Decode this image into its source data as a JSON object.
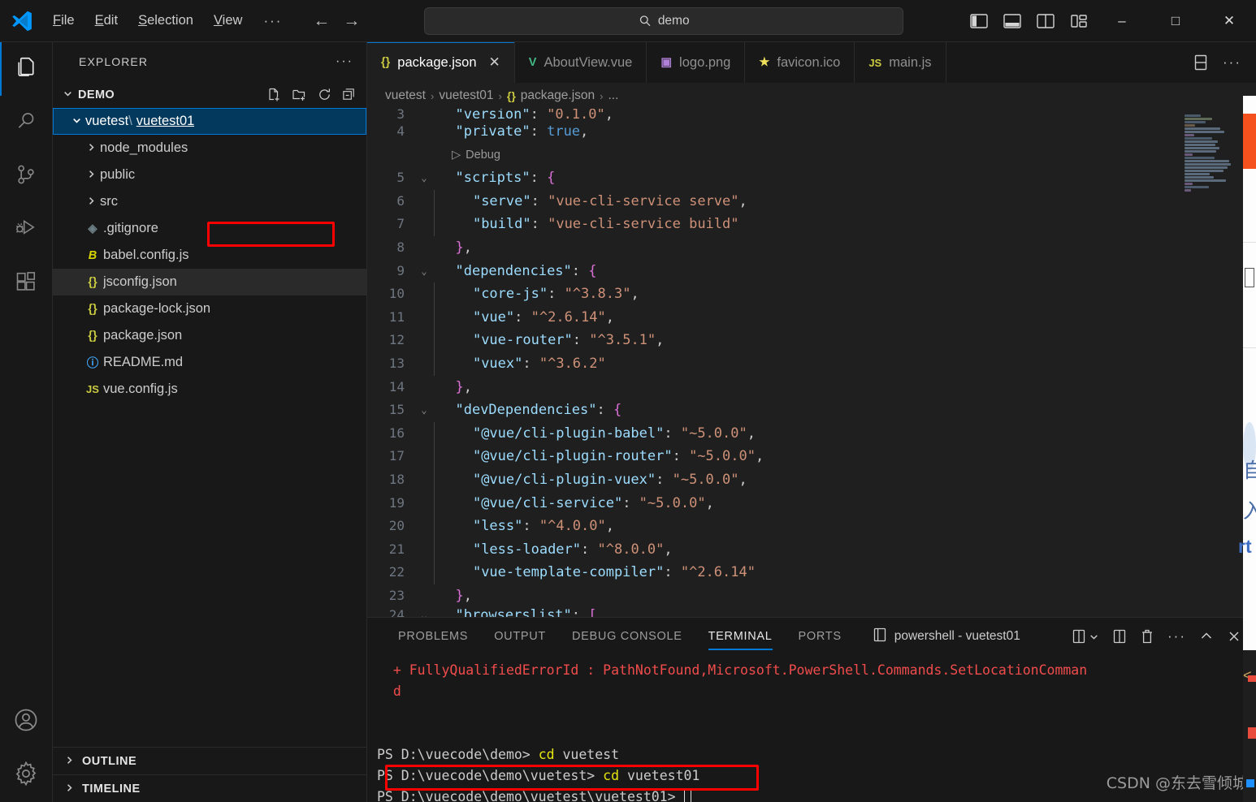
{
  "titlebar": {
    "menu": [
      "File",
      "Edit",
      "Selection",
      "View"
    ],
    "menu_more": "···",
    "back_icon": "←",
    "forward_icon": "→",
    "search_placeholder": "demo",
    "search_value": "demo",
    "window_minimize": "–",
    "window_maximize": "□",
    "window_close": "✕"
  },
  "activitybar": {
    "items": [
      {
        "name": "explorer",
        "title": "Explorer",
        "active": true
      },
      {
        "name": "search",
        "title": "Search",
        "active": false
      },
      {
        "name": "source-control",
        "title": "Source Control",
        "active": false
      },
      {
        "name": "run-debug",
        "title": "Run and Debug",
        "active": false
      },
      {
        "name": "extensions",
        "title": "Extensions",
        "active": false
      }
    ],
    "bottom": [
      {
        "name": "accounts",
        "title": "Accounts"
      },
      {
        "name": "settings",
        "title": "Manage"
      }
    ]
  },
  "sidebar": {
    "title": "EXPLORER",
    "more_label": "···",
    "folder": {
      "label": "DEMO",
      "chevron": "⌄",
      "actions": [
        "new-file",
        "new-folder",
        "refresh",
        "collapse-all"
      ]
    },
    "tree": [
      {
        "label": "vuetest\\vuetest01",
        "label_prefix": "vuetest",
        "label_sep": "\\",
        "label_highlight": "vuetest01",
        "type": "folder",
        "arrow": "⌄",
        "selected": true,
        "indent": 0,
        "annotated": true
      },
      {
        "label": "node_modules",
        "type": "folder",
        "arrow": "›",
        "indent": 1
      },
      {
        "label": "public",
        "type": "folder",
        "arrow": "›",
        "indent": 1
      },
      {
        "label": "src",
        "type": "folder",
        "arrow": "›",
        "indent": 1
      },
      {
        "label": ".gitignore",
        "type": "file",
        "icon": "git",
        "icon_text": "◈",
        "indent": 1
      },
      {
        "label": "babel.config.js",
        "type": "file",
        "icon": "babel",
        "icon_text": "B",
        "indent": 1
      },
      {
        "label": "jsconfig.json",
        "type": "file",
        "icon": "json",
        "icon_text": "{}",
        "indent": 1,
        "hover": true
      },
      {
        "label": "package-lock.json",
        "type": "file",
        "icon": "json",
        "icon_text": "{}",
        "indent": 1
      },
      {
        "label": "package.json",
        "type": "file",
        "icon": "json",
        "icon_text": "{}",
        "indent": 1
      },
      {
        "label": "README.md",
        "type": "file",
        "icon": "md",
        "icon_text": "ⓘ",
        "indent": 1
      },
      {
        "label": "vue.config.js",
        "type": "file",
        "icon": "js",
        "icon_text": "JS",
        "indent": 1
      }
    ],
    "sections": [
      {
        "label": "OUTLINE",
        "chevron": "›"
      },
      {
        "label": "TIMELINE",
        "chevron": "›"
      }
    ]
  },
  "editor": {
    "tabs": [
      {
        "label": "package.json",
        "icon_text": "{}",
        "icon_kind": "json",
        "active": true,
        "has_close": true,
        "close": "✕"
      },
      {
        "label": "AboutView.vue",
        "icon_text": "V",
        "icon_kind": "vue",
        "active": false
      },
      {
        "label": "logo.png",
        "icon_text": "▣",
        "icon_kind": "png",
        "active": false
      },
      {
        "label": "favicon.ico",
        "icon_text": "★",
        "icon_kind": "ico",
        "active": false
      },
      {
        "label": "main.js",
        "icon_text": "JS",
        "icon_kind": "js",
        "active": false
      }
    ],
    "tab_actions": [
      "split-editor-down",
      "more-actions"
    ],
    "breadcrumb": [
      {
        "label": "vuetest",
        "icon": ""
      },
      {
        "label": "vuetest01",
        "icon": ""
      },
      {
        "label": "package.json",
        "icon": "{}"
      },
      {
        "label": "...",
        "icon": ""
      }
    ],
    "breadcrumb_sep": "›",
    "codelens": {
      "icon": "▷",
      "label": "Debug"
    },
    "lines": [
      {
        "num": "3",
        "fold": "",
        "partial_top": true,
        "tokens": [
          {
            "t": "  ",
            "c": "pun"
          },
          {
            "t": "\"version\"",
            "c": "key"
          },
          {
            "t": ": ",
            "c": "pun"
          },
          {
            "t": "\"0.1.0\"",
            "c": "str"
          },
          {
            "t": ",",
            "c": "pun"
          }
        ]
      },
      {
        "num": "4",
        "fold": "",
        "tokens": [
          {
            "t": "  ",
            "c": "pun"
          },
          {
            "t": "\"private\"",
            "c": "key"
          },
          {
            "t": ": ",
            "c": "pun"
          },
          {
            "t": "true",
            "c": "kw"
          },
          {
            "t": ",",
            "c": "pun"
          }
        ]
      },
      {
        "num": "",
        "fold": "",
        "codelens": true
      },
      {
        "num": "5",
        "fold": "⌄",
        "tokens": [
          {
            "t": "  ",
            "c": "pun"
          },
          {
            "t": "\"scripts\"",
            "c": "key"
          },
          {
            "t": ": ",
            "c": "pun"
          },
          {
            "t": "{",
            "c": "brc"
          }
        ]
      },
      {
        "num": "6",
        "fold": "",
        "indentguide": true,
        "tokens": [
          {
            "t": "    ",
            "c": "pun"
          },
          {
            "t": "\"serve\"",
            "c": "key"
          },
          {
            "t": ": ",
            "c": "pun"
          },
          {
            "t": "\"vue-cli-service serve\"",
            "c": "str"
          },
          {
            "t": ",",
            "c": "pun"
          }
        ]
      },
      {
        "num": "7",
        "fold": "",
        "indentguide": true,
        "tokens": [
          {
            "t": "    ",
            "c": "pun"
          },
          {
            "t": "\"build\"",
            "c": "key"
          },
          {
            "t": ": ",
            "c": "pun"
          },
          {
            "t": "\"vue-cli-service build\"",
            "c": "str"
          }
        ]
      },
      {
        "num": "8",
        "fold": "",
        "tokens": [
          {
            "t": "  ",
            "c": "pun"
          },
          {
            "t": "}",
            "c": "brc"
          },
          {
            "t": ",",
            "c": "pun"
          }
        ]
      },
      {
        "num": "9",
        "fold": "⌄",
        "tokens": [
          {
            "t": "  ",
            "c": "pun"
          },
          {
            "t": "\"dependencies\"",
            "c": "key"
          },
          {
            "t": ": ",
            "c": "pun"
          },
          {
            "t": "{",
            "c": "brc"
          }
        ]
      },
      {
        "num": "10",
        "fold": "",
        "indentguide": true,
        "tokens": [
          {
            "t": "    ",
            "c": "pun"
          },
          {
            "t": "\"core-js\"",
            "c": "key"
          },
          {
            "t": ": ",
            "c": "pun"
          },
          {
            "t": "\"^3.8.3\"",
            "c": "str"
          },
          {
            "t": ",",
            "c": "pun"
          }
        ]
      },
      {
        "num": "11",
        "fold": "",
        "indentguide": true,
        "tokens": [
          {
            "t": "    ",
            "c": "pun"
          },
          {
            "t": "\"vue\"",
            "c": "key"
          },
          {
            "t": ": ",
            "c": "pun"
          },
          {
            "t": "\"^2.6.14\"",
            "c": "str"
          },
          {
            "t": ",",
            "c": "pun"
          }
        ]
      },
      {
        "num": "12",
        "fold": "",
        "indentguide": true,
        "tokens": [
          {
            "t": "    ",
            "c": "pun"
          },
          {
            "t": "\"vue-router\"",
            "c": "key"
          },
          {
            "t": ": ",
            "c": "pun"
          },
          {
            "t": "\"^3.5.1\"",
            "c": "str"
          },
          {
            "t": ",",
            "c": "pun"
          }
        ]
      },
      {
        "num": "13",
        "fold": "",
        "indentguide": true,
        "tokens": [
          {
            "t": "    ",
            "c": "pun"
          },
          {
            "t": "\"vuex\"",
            "c": "key"
          },
          {
            "t": ": ",
            "c": "pun"
          },
          {
            "t": "\"^3.6.2\"",
            "c": "str"
          }
        ]
      },
      {
        "num": "14",
        "fold": "",
        "tokens": [
          {
            "t": "  ",
            "c": "pun"
          },
          {
            "t": "}",
            "c": "brc"
          },
          {
            "t": ",",
            "c": "pun"
          }
        ]
      },
      {
        "num": "15",
        "fold": "⌄",
        "tokens": [
          {
            "t": "  ",
            "c": "pun"
          },
          {
            "t": "\"devDependencies\"",
            "c": "key"
          },
          {
            "t": ": ",
            "c": "pun"
          },
          {
            "t": "{",
            "c": "brc"
          }
        ]
      },
      {
        "num": "16",
        "fold": "",
        "indentguide": true,
        "tokens": [
          {
            "t": "    ",
            "c": "pun"
          },
          {
            "t": "\"@vue/cli-plugin-babel\"",
            "c": "key"
          },
          {
            "t": ": ",
            "c": "pun"
          },
          {
            "t": "\"~5.0.0\"",
            "c": "str"
          },
          {
            "t": ",",
            "c": "pun"
          }
        ]
      },
      {
        "num": "17",
        "fold": "",
        "indentguide": true,
        "tokens": [
          {
            "t": "    ",
            "c": "pun"
          },
          {
            "t": "\"@vue/cli-plugin-router\"",
            "c": "key"
          },
          {
            "t": ": ",
            "c": "pun"
          },
          {
            "t": "\"~5.0.0\"",
            "c": "str"
          },
          {
            "t": ",",
            "c": "pun"
          }
        ]
      },
      {
        "num": "18",
        "fold": "",
        "indentguide": true,
        "tokens": [
          {
            "t": "    ",
            "c": "pun"
          },
          {
            "t": "\"@vue/cli-plugin-vuex\"",
            "c": "key"
          },
          {
            "t": ": ",
            "c": "pun"
          },
          {
            "t": "\"~5.0.0\"",
            "c": "str"
          },
          {
            "t": ",",
            "c": "pun"
          }
        ]
      },
      {
        "num": "19",
        "fold": "",
        "indentguide": true,
        "tokens": [
          {
            "t": "    ",
            "c": "pun"
          },
          {
            "t": "\"@vue/cli-service\"",
            "c": "key"
          },
          {
            "t": ": ",
            "c": "pun"
          },
          {
            "t": "\"~5.0.0\"",
            "c": "str"
          },
          {
            "t": ",",
            "c": "pun"
          }
        ]
      },
      {
        "num": "20",
        "fold": "",
        "indentguide": true,
        "tokens": [
          {
            "t": "    ",
            "c": "pun"
          },
          {
            "t": "\"less\"",
            "c": "key"
          },
          {
            "t": ": ",
            "c": "pun"
          },
          {
            "t": "\"^4.0.0\"",
            "c": "str"
          },
          {
            "t": ",",
            "c": "pun"
          }
        ]
      },
      {
        "num": "21",
        "fold": "",
        "indentguide": true,
        "tokens": [
          {
            "t": "    ",
            "c": "pun"
          },
          {
            "t": "\"less-loader\"",
            "c": "key"
          },
          {
            "t": ": ",
            "c": "pun"
          },
          {
            "t": "\"^8.0.0\"",
            "c": "str"
          },
          {
            "t": ",",
            "c": "pun"
          }
        ]
      },
      {
        "num": "22",
        "fold": "",
        "indentguide": true,
        "tokens": [
          {
            "t": "    ",
            "c": "pun"
          },
          {
            "t": "\"vue-template-compiler\"",
            "c": "key"
          },
          {
            "t": ": ",
            "c": "pun"
          },
          {
            "t": "\"^2.6.14\"",
            "c": "str"
          }
        ]
      },
      {
        "num": "23",
        "fold": "",
        "tokens": [
          {
            "t": "  ",
            "c": "pun"
          },
          {
            "t": "}",
            "c": "brc"
          },
          {
            "t": ",",
            "c": "pun"
          }
        ]
      },
      {
        "num": "24",
        "fold": "⌄",
        "partial_bottom": true,
        "tokens": [
          {
            "t": "  ",
            "c": "pun"
          },
          {
            "t": "\"browserslist\"",
            "c": "key"
          },
          {
            "t": ": ",
            "c": "pun"
          },
          {
            "t": "[",
            "c": "brc"
          }
        ]
      }
    ]
  },
  "panel": {
    "tabs": [
      {
        "label": "PROBLEMS",
        "active": false
      },
      {
        "label": "OUTPUT",
        "active": false
      },
      {
        "label": "DEBUG CONSOLE",
        "active": false
      },
      {
        "label": "TERMINAL",
        "active": true
      },
      {
        "label": "PORTS",
        "active": false
      }
    ],
    "terminal_selector": "powershell - vuetest01",
    "actions": [
      "split-terminal-dropdown",
      "split-terminal",
      "kill-terminal",
      "more-actions",
      "maximize-panel",
      "close-panel"
    ],
    "terminal_lines": [
      {
        "segments": [
          {
            "t": "  + FullyQualifiedErrorId : PathNotFound,Microsoft.PowerShell.Commands.SetLocationComman",
            "c": "err"
          }
        ]
      },
      {
        "segments": [
          {
            "t": "  d",
            "c": "err"
          }
        ]
      },
      {
        "segments": [
          {
            "t": "",
            "c": "normal"
          }
        ]
      },
      {
        "segments": [
          {
            "t": "",
            "c": "normal"
          }
        ]
      },
      {
        "segments": [
          {
            "t": "PS D:\\vuecode\\demo> ",
            "c": "normal"
          },
          {
            "t": "cd",
            "c": "cmd"
          },
          {
            "t": " vuetest",
            "c": "normal"
          }
        ]
      },
      {
        "segments": [
          {
            "t": "PS D:\\vuecode\\demo\\vuetest> ",
            "c": "normal"
          },
          {
            "t": "cd",
            "c": "cmd"
          },
          {
            "t": " vuetest01",
            "c": "normal"
          }
        ]
      },
      {
        "segments": [
          {
            "t": "PS D:\\vuecode\\demo\\vuetest\\vuetest01> ",
            "c": "normal"
          }
        ],
        "cursor": true,
        "annotated": true
      }
    ]
  },
  "watermark": "CSDN @东去雪倾城",
  "colors": {
    "accent": "#0078d4",
    "selection": "#04395e",
    "annotation": "#fe0000",
    "bg": "#1f1f1f",
    "chrome": "#181818",
    "error": "#f14c4c"
  }
}
